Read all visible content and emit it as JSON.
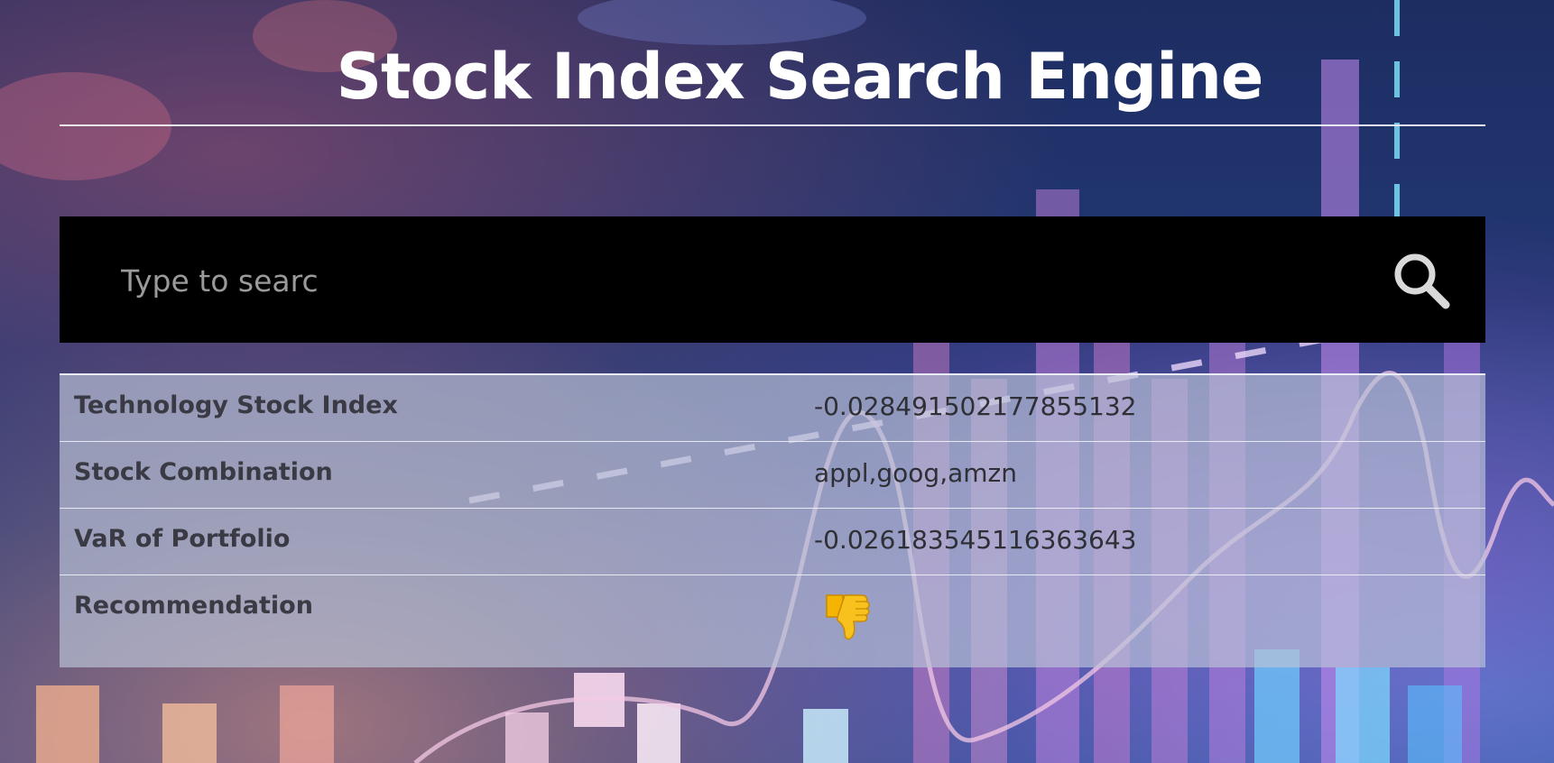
{
  "header": {
    "title": "Stock Index Search Engine"
  },
  "search": {
    "placeholder": "Type to searc",
    "value": "",
    "button_icon": "search-icon"
  },
  "results": {
    "rows": [
      {
        "label": "Technology Stock Index",
        "value": "-0.028491502177855132"
      },
      {
        "label": "Stock Combination",
        "value": "appl,goog,amzn"
      },
      {
        "label": "VaR of Portfolio",
        "value": "-0.026183545116363643"
      },
      {
        "label": "Recommendation",
        "icon": "thumbs-down-icon"
      }
    ]
  },
  "colors": {
    "title_text": "#ffffff",
    "search_bg": "#000000",
    "table_bg": "#b9c3d7",
    "thumb": "#f5b400"
  }
}
